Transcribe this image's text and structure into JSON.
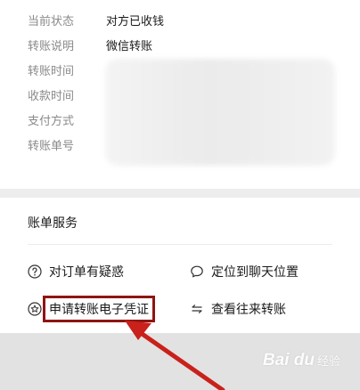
{
  "details": {
    "rows": [
      {
        "label": "当前状态",
        "value": "对方已收钱"
      },
      {
        "label": "转账说明",
        "value": "微信转账"
      },
      {
        "label": "转账时间",
        "value": ""
      },
      {
        "label": "收款时间",
        "value": ""
      },
      {
        "label": "支付方式",
        "value": ""
      },
      {
        "label": "转账单号",
        "value": ""
      }
    ]
  },
  "services": {
    "title": "账单服务",
    "items": [
      {
        "label": "对订单有疑惑",
        "icon": "question-circle-icon"
      },
      {
        "label": "定位到聊天位置",
        "icon": "chat-bubble-icon"
      },
      {
        "label": "申请转账电子凭证",
        "icon": "star-circle-icon"
      },
      {
        "label": "查看往来转账",
        "icon": "exchange-arrows-icon"
      }
    ]
  },
  "annotation": {
    "highlight_color": "#8e1512",
    "arrow_color": "#c9211b"
  },
  "watermark": {
    "logo": "Bai du",
    "suffix": "经验"
  }
}
